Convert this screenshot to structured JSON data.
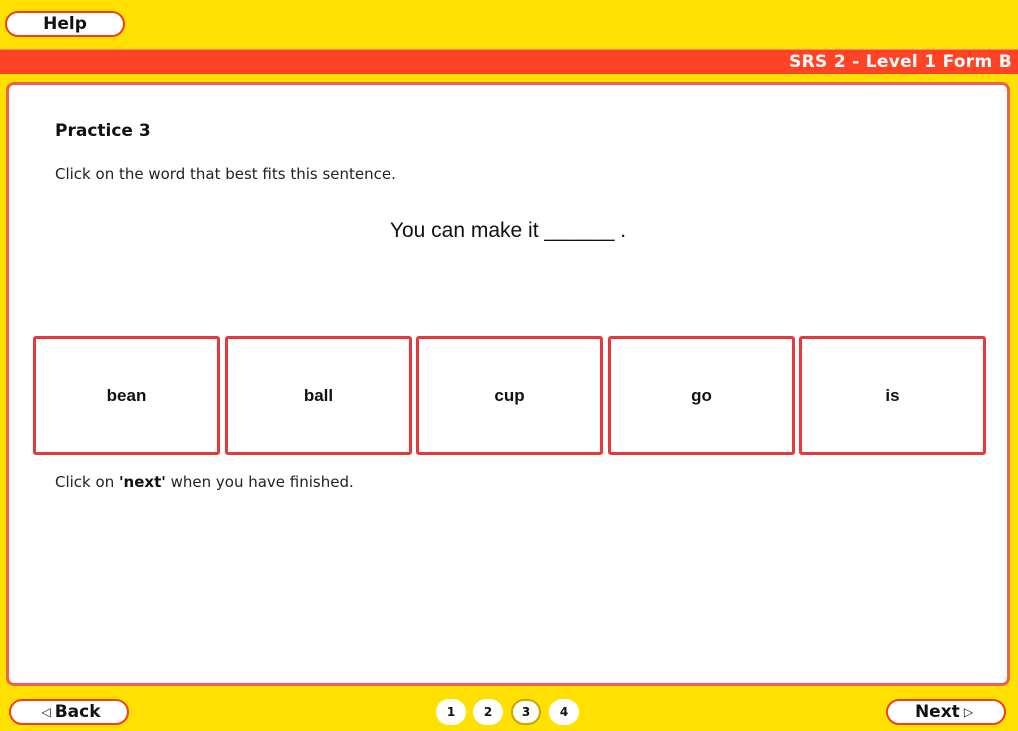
{
  "header": {
    "help_label": "Help",
    "form_title": "SRS 2 - Level 1 Form B"
  },
  "question": {
    "title": "Practice 3",
    "instruction": "Click on the word that best fits this sentence.",
    "sentence": "You can make it ______ .",
    "choices": [
      "bean",
      "ball",
      "cup",
      "go",
      "is"
    ],
    "finish_prefix": "Click on ",
    "finish_keyword": "'next'",
    "finish_suffix": " when you have finished."
  },
  "footer": {
    "back_label": "Back",
    "next_label": "Next",
    "back_arrow": "◁",
    "next_arrow": "▷",
    "pages": [
      "1",
      "2",
      "3",
      "4"
    ],
    "current_page": "3"
  },
  "colors": {
    "background": "#ffe000",
    "title_bar": "#ff4326",
    "accent_border": "#e8383c"
  }
}
